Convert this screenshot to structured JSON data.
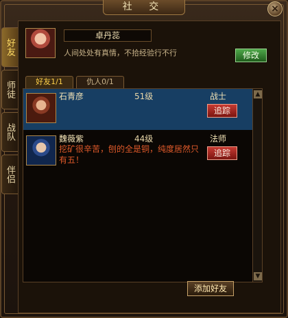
{
  "window": {
    "title": "社  交",
    "close_label": "×"
  },
  "side_tabs": [
    {
      "label": "好友"
    },
    {
      "label": "师徒"
    },
    {
      "label": "战队"
    },
    {
      "label": "伴侣"
    }
  ],
  "self": {
    "name": "卓丹蕊",
    "signature": "人间处处有真情，不拾经验行不行",
    "edit_label": "修改"
  },
  "list_tabs": [
    {
      "label": "好友1/1"
    },
    {
      "label": "仇人0/1"
    }
  ],
  "friends": [
    {
      "name": "石青彦",
      "level": "51级",
      "class": "战士",
      "desc": "",
      "action": "追踪"
    },
    {
      "name": "魏薇紫",
      "level": "44级",
      "class": "法师",
      "desc": "挖矿很辛苦，刨的全是铜，纯度居然只有五！",
      "action": "追踪"
    }
  ],
  "footer": {
    "add_label": "添加好友"
  }
}
